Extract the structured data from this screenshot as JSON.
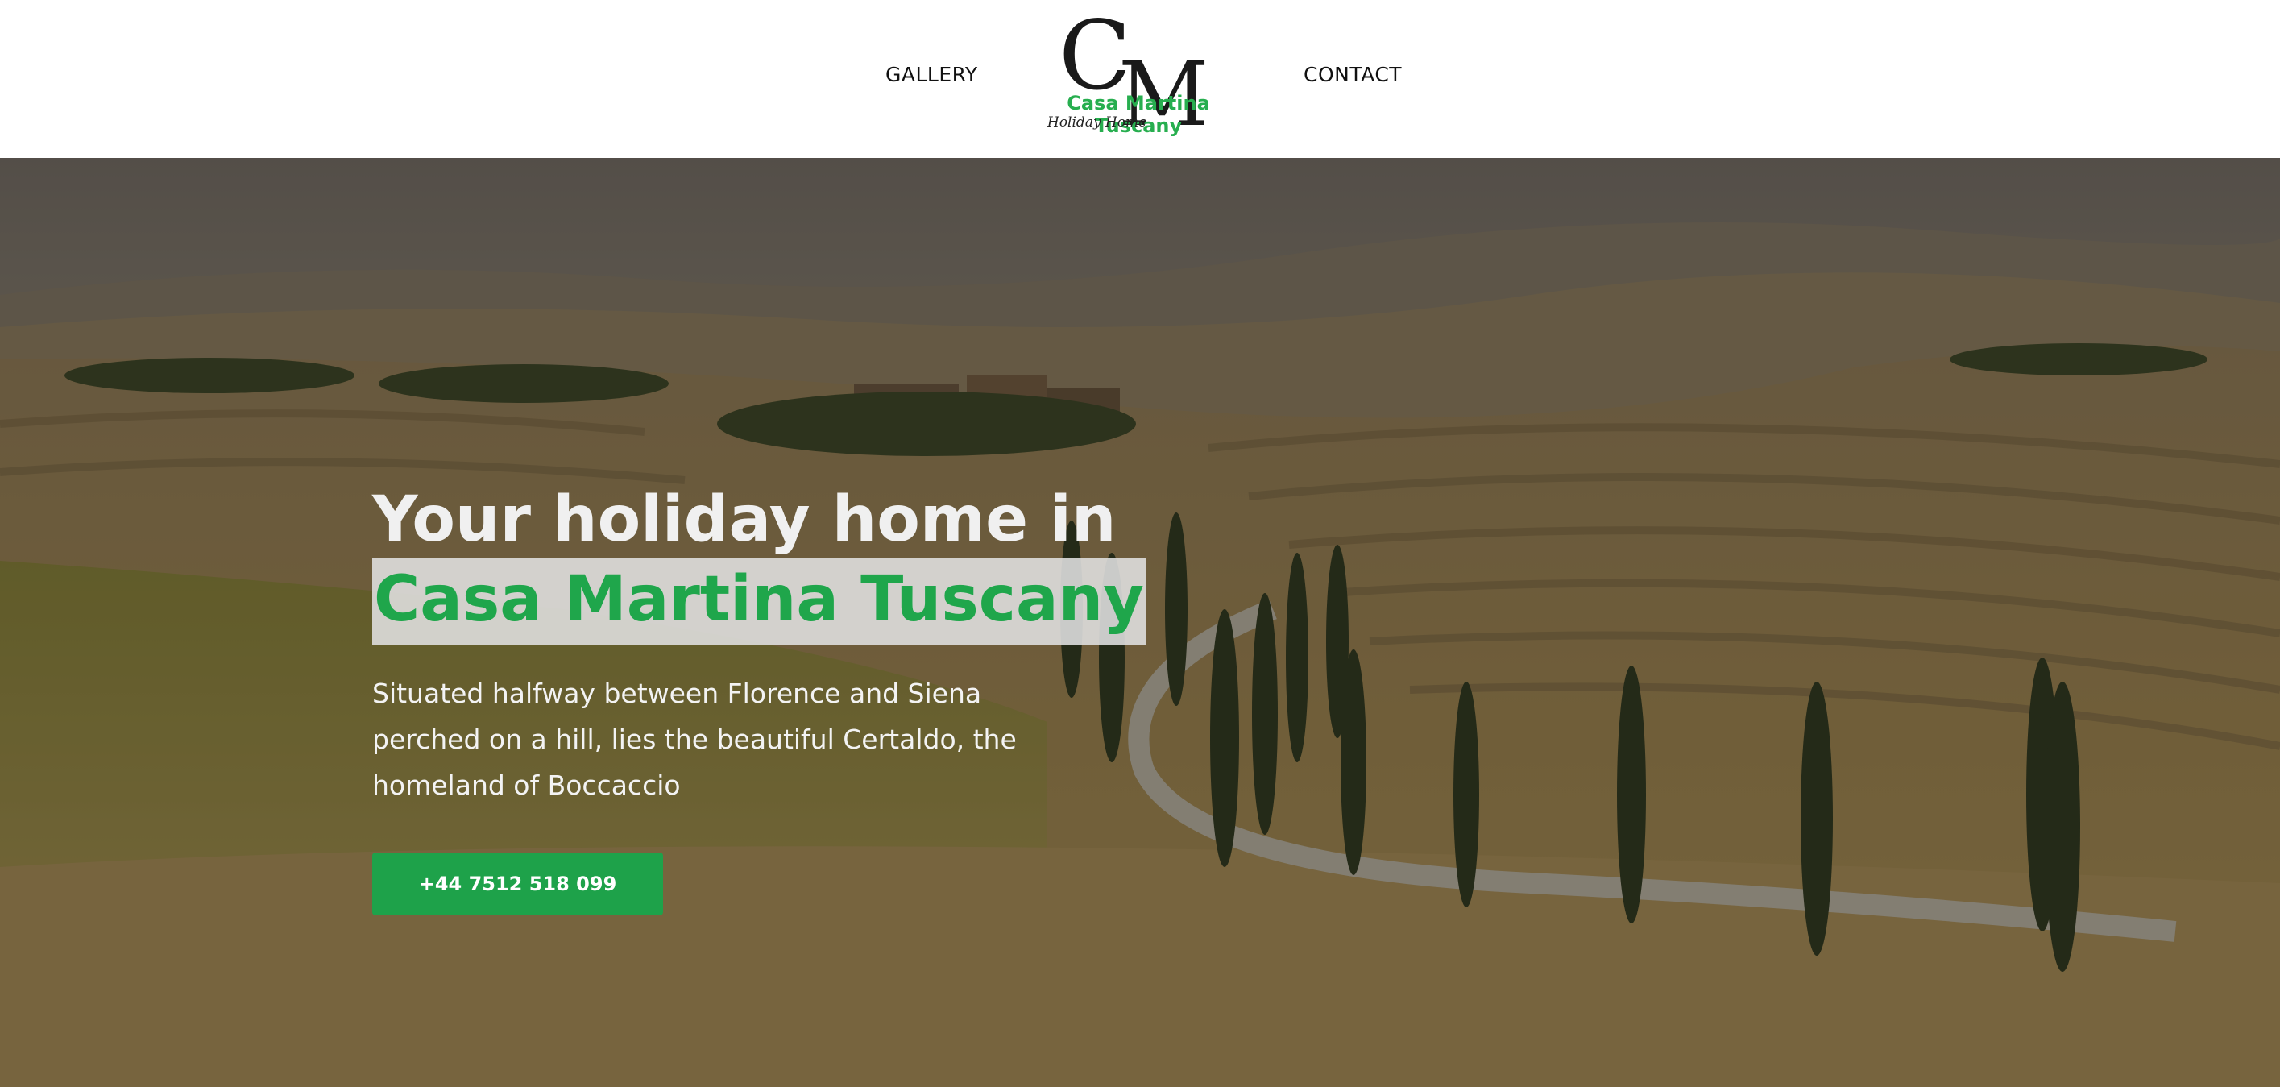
{
  "nav": {
    "gallery_label": "GALLERY",
    "contact_label": "CONTACT"
  },
  "logo": {
    "monogram_c": "C",
    "monogram_m": "M",
    "name": "Casa Martina Tuscany",
    "tagline": "Holiday Home",
    "name_color": "#27ae4f"
  },
  "hero": {
    "title_line1": "Your holiday home in",
    "title_line2": "Casa Martina Tuscany",
    "description": "Situated halfway between Florence and Siena perched on a hill, lies the beautiful Certaldo, the homeland of Boccaccio",
    "cta_label": "+44 7512 518 099",
    "background_image": "tuscan-landscape-cypress-road",
    "accent_color": "#1ea24a"
  }
}
